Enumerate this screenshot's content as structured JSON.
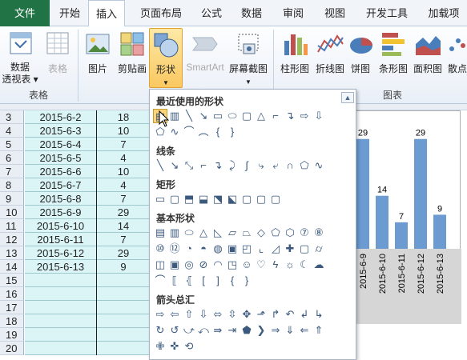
{
  "tabs": [
    "文件",
    "开始",
    "插入",
    "页面布局",
    "公式",
    "数据",
    "审阅",
    "视图",
    "开发工具",
    "加载项"
  ],
  "ribbon": {
    "pivot": "数据\n透视表",
    "pivot_line1": "数据",
    "pivot_line2": "透视表",
    "table": "表格",
    "picture": "图片",
    "clipart": "剪贴画",
    "shapes": "形状",
    "smartart": "SmartArt",
    "screenshot": "屏幕截图",
    "col_chart": "柱形图",
    "line_chart": "折线图",
    "pie_chart": "饼图",
    "bar_chart": "条形图",
    "area_chart": "面积图",
    "scatter_chart": "散点",
    "group_tables": "表格",
    "group_charts": "图表"
  },
  "shapes_menu": {
    "recent": "最近使用的形状",
    "lines": "线条",
    "rect": "矩形",
    "basic": "基本形状",
    "arrows": "箭头总汇"
  },
  "rows": [
    {
      "num": "3",
      "date": "2015-6-2",
      "val": "18"
    },
    {
      "num": "4",
      "date": "2015-6-3",
      "val": "10"
    },
    {
      "num": "5",
      "date": "2015-6-4",
      "val": "7"
    },
    {
      "num": "6",
      "date": "2015-6-5",
      "val": "4"
    },
    {
      "num": "7",
      "date": "2015-6-6",
      "val": "10"
    },
    {
      "num": "8",
      "date": "2015-6-7",
      "val": "4"
    },
    {
      "num": "9",
      "date": "2015-6-8",
      "val": "7"
    },
    {
      "num": "10",
      "date": "2015-6-9",
      "val": "29"
    },
    {
      "num": "11",
      "date": "2015-6-10",
      "val": "14"
    },
    {
      "num": "12",
      "date": "2015-6-11",
      "val": "7"
    },
    {
      "num": "13",
      "date": "2015-6-12",
      "val": "29"
    },
    {
      "num": "14",
      "date": "2015-6-13",
      "val": "9"
    },
    {
      "num": "15",
      "date": "",
      "val": ""
    },
    {
      "num": "16",
      "date": "",
      "val": ""
    },
    {
      "num": "17",
      "date": "",
      "val": ""
    },
    {
      "num": "18",
      "date": "",
      "val": ""
    },
    {
      "num": "19",
      "date": "",
      "val": ""
    },
    {
      "num": "20",
      "date": "",
      "val": ""
    }
  ],
  "chart_data": {
    "type": "bar",
    "categories": [
      "2015-6-9",
      "2015-6-10",
      "2015-6-11",
      "2015-6-12",
      "2015-6-13"
    ],
    "values": [
      29,
      14,
      7,
      29,
      9
    ],
    "title": "",
    "xlabel": "",
    "ylabel": "",
    "bar_color": "#6b9bd1"
  },
  "colors": {
    "file_tab": "#217346",
    "accent": "#f9c861"
  }
}
